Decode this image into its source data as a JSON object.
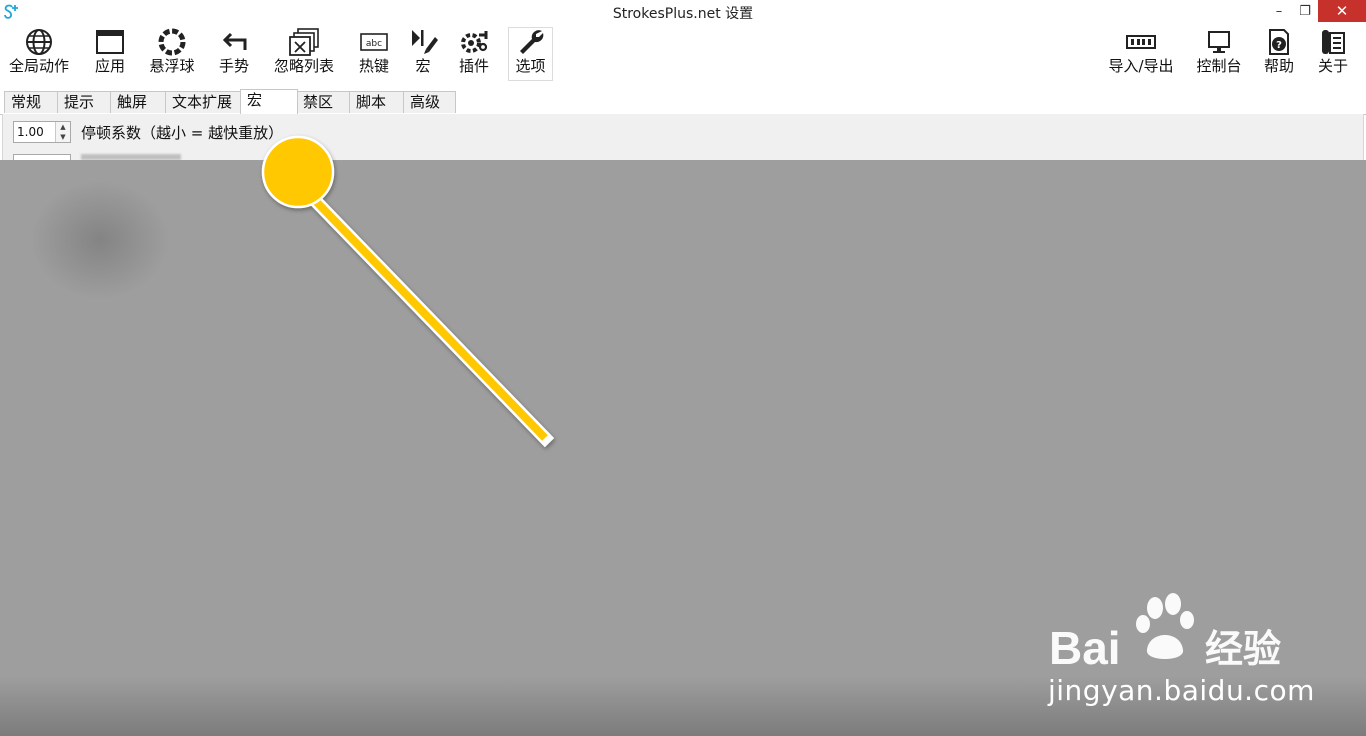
{
  "window": {
    "title": "StrokesPlus.net 设置",
    "minimize_symbol": "–",
    "restore_symbol": "❐",
    "close_symbol": "✕"
  },
  "toolbar": {
    "items": [
      {
        "label": "全局动作",
        "icon": "globe-icon"
      },
      {
        "label": "应用",
        "icon": "window-icon"
      },
      {
        "label": "悬浮球",
        "icon": "ring-icon"
      },
      {
        "label": "手势",
        "icon": "gesture-arrow-icon"
      },
      {
        "label": "忽略列表",
        "icon": "ignore-list-icon"
      },
      {
        "label": "热键",
        "icon": "keyboard-icon",
        "icon_text": "abc"
      },
      {
        "label": "宏",
        "icon": "macro-icon"
      },
      {
        "label": "插件",
        "icon": "plugin-icon"
      },
      {
        "label": "选项",
        "icon": "wrench-icon",
        "active": true
      }
    ],
    "right_items": [
      {
        "label": "导入/导出",
        "icon": "import-export-icon"
      },
      {
        "label": "控制台",
        "icon": "monitor-icon"
      },
      {
        "label": "帮助",
        "icon": "help-icon"
      },
      {
        "label": "关于",
        "icon": "about-icon"
      }
    ]
  },
  "tabs": [
    {
      "label": "常规"
    },
    {
      "label": "提示"
    },
    {
      "label": "触屏"
    },
    {
      "label": "文本扩展"
    },
    {
      "label": "宏",
      "active": true
    },
    {
      "label": "禁区"
    },
    {
      "label": "脚本"
    },
    {
      "label": "高级"
    }
  ],
  "settings": {
    "pause_factor_value": "1.00",
    "pause_factor_label": "停顿系数（越小 = 越快重放）",
    "spin_up": "▲",
    "spin_down": "▼"
  },
  "watermark": {
    "logo_text": "Bai经验",
    "url": "jingyan.baidu.com"
  },
  "colors": {
    "overlay": "#9e9e9e",
    "pointer": "#ffc800",
    "close_button": "#c7312b"
  }
}
